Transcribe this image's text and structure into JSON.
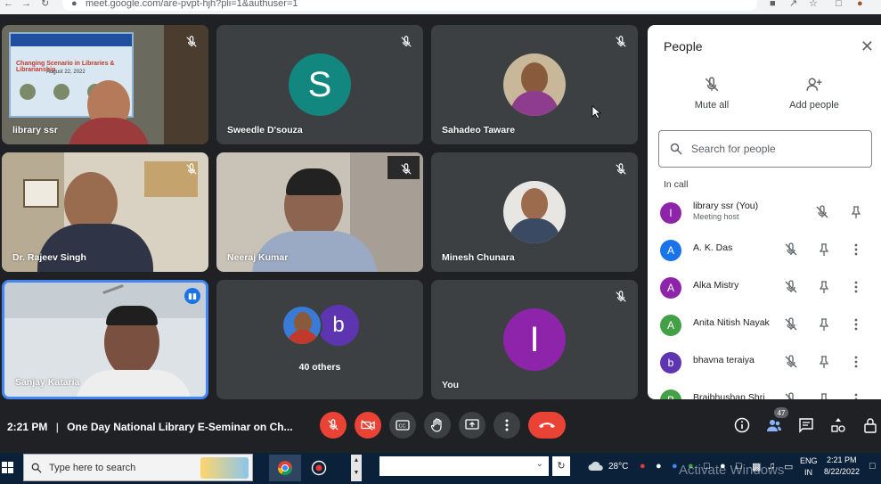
{
  "browser": {
    "url": "meet.google.com/are-pvpt-hjh?pli=1&authuser=1"
  },
  "tiles": [
    {
      "name": "library ssr",
      "kind": "video",
      "muted": true
    },
    {
      "name": "Sweedle D'souza",
      "kind": "avatar",
      "initial": "S",
      "color": "#12877f",
      "muted": true
    },
    {
      "name": "Sahadeo Taware",
      "kind": "photo",
      "muted": true
    },
    {
      "name": "Dr. Rajeev Singh",
      "kind": "video",
      "muted": true
    },
    {
      "name": "Neeraj Kumar",
      "kind": "video",
      "muted": true
    },
    {
      "name": "Minesh Chunara",
      "kind": "photo",
      "muted": true
    },
    {
      "name": "Sanjay Kataria",
      "kind": "video",
      "speaking": true
    },
    {
      "name": "",
      "kind": "others",
      "initial": "b",
      "caption": "40 others"
    },
    {
      "name": "You",
      "kind": "avatar",
      "initial": "I",
      "color": "#8e24aa",
      "muted": true
    }
  ],
  "poster_text": [
    "Changing Scenario in Libraries & Librarianship",
    "August 22, 2022"
  ],
  "panel": {
    "title": "People",
    "mute_all": "Mute all",
    "add_people": "Add people",
    "search_placeholder": "Search for people",
    "section": "In call",
    "people": [
      {
        "initial": "l",
        "name": "library ssr (You)",
        "sub": "Meeting host",
        "color": "#8e24aa"
      },
      {
        "initial": "A",
        "name": "A. K. Das",
        "color": "#1a73e8"
      },
      {
        "initial": "A",
        "name": "Alka Mistry",
        "color": "#8e24aa"
      },
      {
        "initial": "A",
        "name": "Anita Nitish Nayak",
        "color": "#43a047"
      },
      {
        "initial": "b",
        "name": "bhavna teraiya",
        "color": "#5e35b1"
      },
      {
        "initial": "B",
        "name": "Brajbhushan Shri",
        "color": "#43a047"
      }
    ]
  },
  "bottom": {
    "time": "2:21 PM",
    "separator": "|",
    "meeting_title": "One Day National Library E-Seminar on Ch...",
    "participant_count": "47"
  },
  "taskbar": {
    "search_text": "Type here to search",
    "weather": "28°C",
    "lang1": "ENG",
    "lang2": "IN",
    "clock_time": "2:21 PM",
    "clock_date": "8/22/2022",
    "watermark": "Activate Windows"
  },
  "colors": {
    "bg": "#202124",
    "tile": "#3c4043",
    "red": "#ea4335",
    "speaking": "#4285f4"
  }
}
